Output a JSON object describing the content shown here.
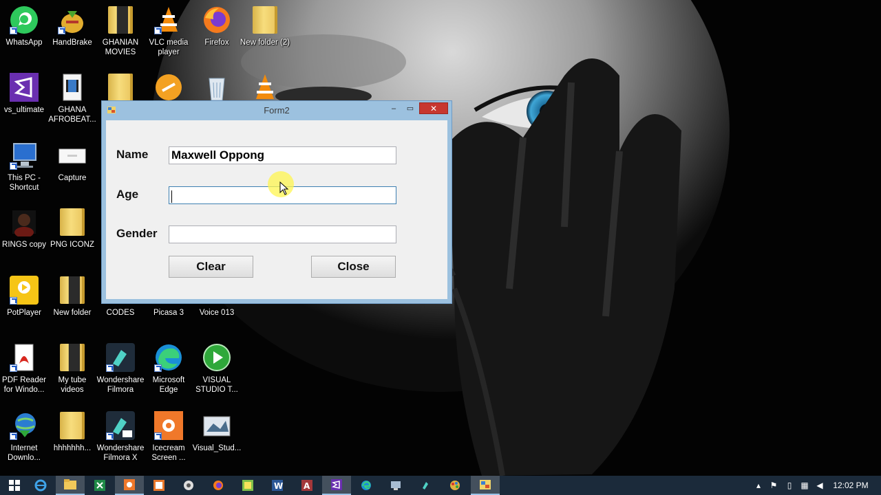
{
  "desktop_icons": [
    {
      "id": "whatsapp",
      "label": "WhatsApp"
    },
    {
      "id": "handbrake",
      "label": "HandBrake"
    },
    {
      "id": "ghanian-movies",
      "label": "GHANIAN MOVIES"
    },
    {
      "id": "vlc",
      "label": "VLC media player"
    },
    {
      "id": "firefox",
      "label": "Firefox"
    },
    {
      "id": "new-folder-2",
      "label": "New folder (2)"
    },
    {
      "id": "vs-ultimate",
      "label": "vs_ultimate"
    },
    {
      "id": "ghana-afrobeat",
      "label": "GHANA AFROBEAT..."
    },
    {
      "id": "this-pc",
      "label": "This PC - Shortcut"
    },
    {
      "id": "capture",
      "label": "Capture"
    },
    {
      "id": "rings-copy",
      "label": "RINGS copy"
    },
    {
      "id": "png-iconz",
      "label": "PNG ICONZ"
    },
    {
      "id": "potplayer",
      "label": "PotPlayer"
    },
    {
      "id": "new-folder",
      "label": "New folder"
    },
    {
      "id": "codes",
      "label": "CODES"
    },
    {
      "id": "picasa",
      "label": "Picasa 3"
    },
    {
      "id": "voice",
      "label": "Voice 013"
    },
    {
      "id": "pdf-reader",
      "label": "PDF Reader for Windo..."
    },
    {
      "id": "my-tube-videos",
      "label": "My tube videos"
    },
    {
      "id": "filmora",
      "label": "Wondershare Filmora"
    },
    {
      "id": "edge",
      "label": "Microsoft Edge"
    },
    {
      "id": "visual-studio-t",
      "label": "VISUAL STUDIO T..."
    },
    {
      "id": "idm",
      "label": "Internet Downlo..."
    },
    {
      "id": "hhh",
      "label": "hhhhhhh..."
    },
    {
      "id": "filmora-x",
      "label": "Wondershare Filmora X"
    },
    {
      "id": "icecream",
      "label": "Icecream Screen ..."
    },
    {
      "id": "visual-stud",
      "label": "Visual_Stud..."
    }
  ],
  "form": {
    "title": "Form2",
    "name_label": "Name",
    "age_label": "Age",
    "gender_label": "Gender",
    "name_value": "Maxwell Oppong",
    "age_value": "",
    "gender_value": "",
    "clear_label": "Clear",
    "close_label": "Close",
    "minimize_glyph": "–",
    "maximize_glyph": "▭",
    "close_glyph": "✕"
  },
  "taskbar": {
    "start_icon": "windows-logo",
    "apps": [
      "internet-explorer",
      "file-explorer",
      "excel",
      "icecream",
      "picture",
      "chrome-like",
      "firefox",
      "notepad",
      "word",
      "access",
      "visual-studio",
      "edge",
      "monitor",
      "media",
      "paint",
      "form-app"
    ],
    "active_app": "visual-studio",
    "clock": "12:02 PM"
  },
  "colors": {
    "window_frame": "#9cc1df",
    "close_button": "#c7372f",
    "taskbar": "#1b2a3a",
    "eye": "#2e8bc0"
  }
}
